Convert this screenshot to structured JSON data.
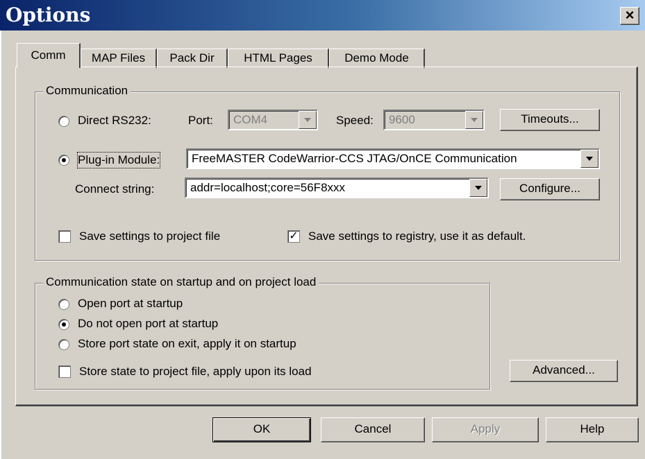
{
  "window": {
    "title": "Options",
    "close_label": "×"
  },
  "tabs": [
    {
      "label": "Comm",
      "active": true
    },
    {
      "label": "MAP Files"
    },
    {
      "label": "Pack Dir"
    },
    {
      "label": "HTML Pages"
    },
    {
      "label": "Demo Mode"
    }
  ],
  "communication": {
    "group_label": "Communication",
    "direct_label": "Direct RS232:",
    "port_label": "Port:",
    "port_value": "COM4",
    "speed_label": "Speed:",
    "speed_value": "9600",
    "timeouts_label": "Timeouts...",
    "plugin_label": "Plug-in Module:",
    "plugin_value": "FreeMASTER CodeWarrior-CCS JTAG/OnCE Communication",
    "connect_label": "Connect string:",
    "connect_value": "addr=localhost;core=56F8xxx",
    "configure_label": "Configure...",
    "save_project_label": "Save settings to project file",
    "save_registry_label": "Save settings to registry, use it as default."
  },
  "startup": {
    "group_label": "Communication state on startup and on project load",
    "options": [
      {
        "label": "Open port at startup",
        "selected": false
      },
      {
        "label": "Do not open port at startup",
        "selected": true
      },
      {
        "label": "Store port state on exit, apply it on startup",
        "selected": false
      }
    ],
    "store_state_label": "Store state to project file, apply upon its load",
    "advanced_label": "Advanced..."
  },
  "footer": {
    "ok_label": "OK",
    "cancel_label": "Cancel",
    "apply_label": "Apply",
    "help_label": "Help"
  }
}
